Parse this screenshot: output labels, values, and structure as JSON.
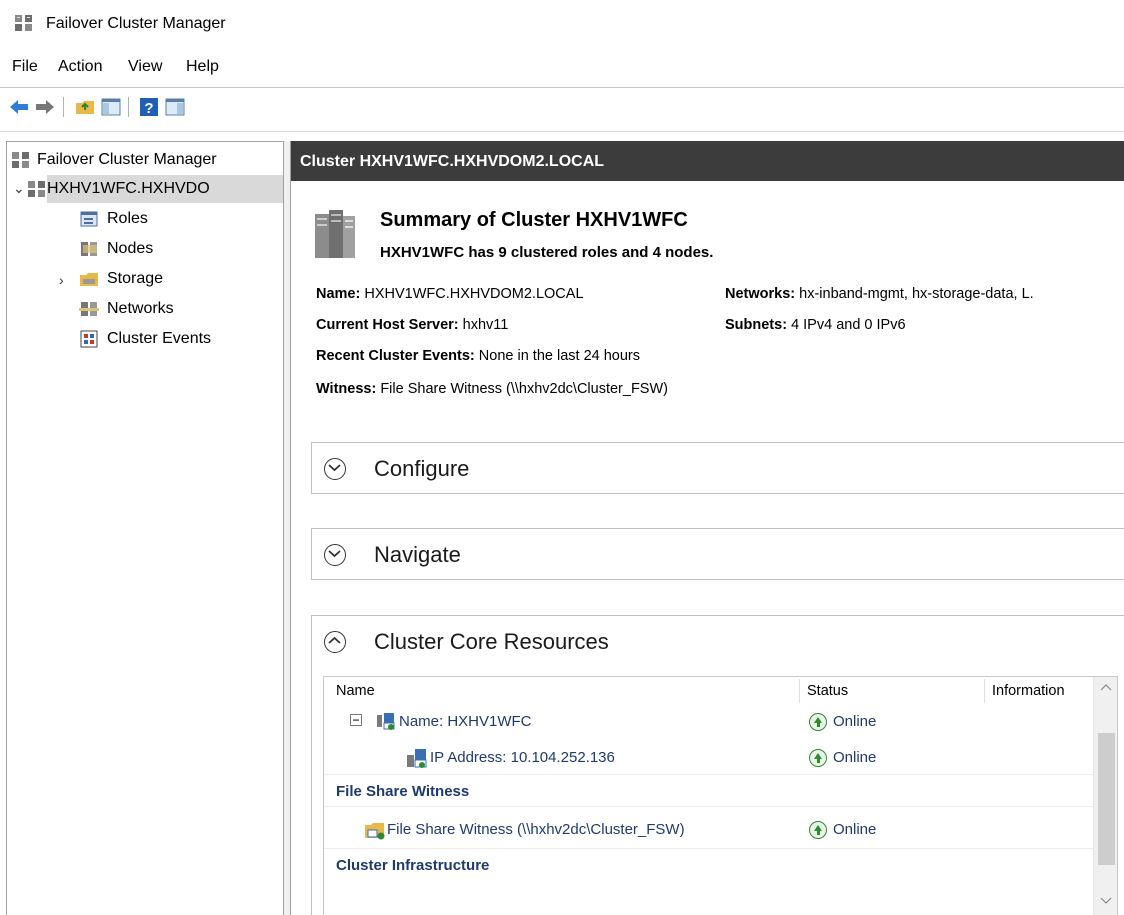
{
  "window": {
    "title": "Failover Cluster Manager"
  },
  "menu": [
    "File",
    "Action",
    "View",
    "Help"
  ],
  "toolbar": {
    "icons": [
      "back-arrow-icon",
      "forward-arrow-icon",
      "up-folder-icon",
      "show-hide-console-tree-icon",
      "help-icon",
      "show-hide-action-pane-icon"
    ]
  },
  "tree": {
    "root": "Failover Cluster Manager",
    "cluster": "HXHV1WFC.HXHVDO",
    "items": [
      {
        "label": "Roles",
        "icon": "roles-icon"
      },
      {
        "label": "Nodes",
        "icon": "nodes-icon"
      },
      {
        "label": "Storage",
        "icon": "storage-icon"
      },
      {
        "label": "Networks",
        "icon": "networks-icon"
      },
      {
        "label": "Cluster Events",
        "icon": "cluster-events-icon"
      }
    ]
  },
  "main": {
    "header": "Cluster HXHV1WFC.HXHVDOM2.LOCAL",
    "summary_title": "Summary of Cluster HXHV1WFC",
    "summary_sub": "HXHV1WFC has 9 clustered roles and 4 nodes.",
    "info": {
      "name_label": "Name:",
      "name_value": "HXHV1WFC.HXHVDOM2.LOCAL",
      "networks_label": "Networks:",
      "networks_value": "hx-inband-mgmt, hx-storage-data, L.",
      "host_label": "Current Host Server:",
      "host_value": "hxhv11",
      "subnets_label": "Subnets:",
      "subnets_value": "4 IPv4 and 0 IPv6",
      "events_label": "Recent Cluster Events:",
      "events_value": "None in the last 24 hours",
      "witness_label": "Witness:",
      "witness_value": "File Share Witness (\\\\hxhv2dc\\Cluster_FSW)"
    },
    "sections": [
      "Configure",
      "Navigate",
      "Cluster Core Resources"
    ],
    "grid": {
      "columns": [
        "Name",
        "Status",
        "Information"
      ],
      "rows": [
        {
          "type": "item",
          "name": "Name: HXHV1WFC",
          "status": "Online"
        },
        {
          "type": "item",
          "name": "IP Address: 10.104.252.136",
          "status": "Online"
        },
        {
          "type": "group",
          "name": "File Share Witness"
        },
        {
          "type": "item",
          "name": "File Share Witness (\\\\hxhv2dc\\Cluster_FSW)",
          "status": "Online"
        },
        {
          "type": "group",
          "name": "Cluster Infrastructure"
        }
      ]
    }
  },
  "colors": {
    "header_bg": "#3c3c3c",
    "online": "#2e8b2e",
    "group_text": "#1f3a6e"
  }
}
